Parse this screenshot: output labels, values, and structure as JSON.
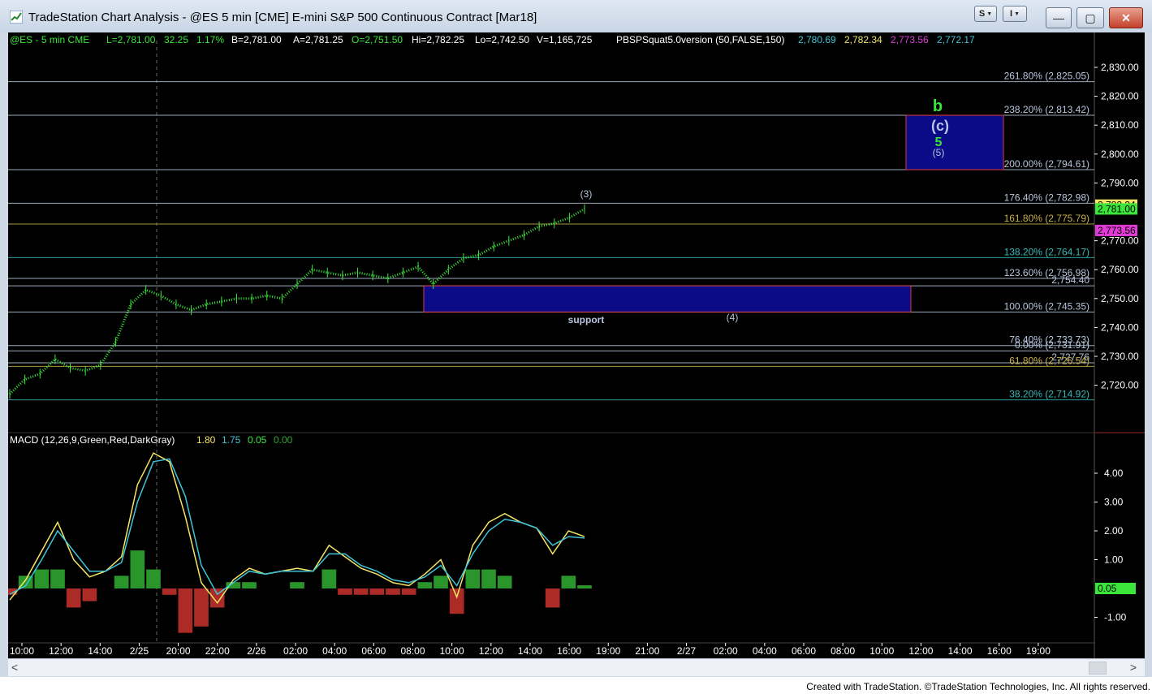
{
  "window": {
    "title": "TradeStation Chart Analysis - @ES 5 min [CME] E-mini S&P 500 Continuous Contract [Mar18]",
    "menu_s": "S",
    "menu_i": "I",
    "minimize_glyph": "—",
    "restore_glyph": "▢",
    "close_glyph": "✕"
  },
  "status": {
    "symbol": "@ES - 5 min  CME",
    "last": "L=2,781.00",
    "change": "32.25",
    "change_pct": "1.17%",
    "bid": "B=2,781.00",
    "ask": "A=2,781.25",
    "open": "O=2,751.50",
    "high": "Hi=2,782.25",
    "low": "Lo=2,742.50",
    "volume": "V=1,165,725",
    "indicator": "PBSPSquat5.0version (50,FALSE,150)",
    "ind_v1": "2,780.69",
    "ind_v2": "2,782.34",
    "ind_v3": "2,773.56",
    "ind_v4": "2,772.17"
  },
  "colors": {
    "background": "#000000",
    "price_green": "#39e639",
    "level_line": "#b7c6de",
    "box_fill": "#0b0b88",
    "box_border": "#e23a3a",
    "macd_line": "#f5e663",
    "signal_line": "#3ec4d6",
    "hist_pos": "#2fa52f",
    "hist_neg": "#c0302a",
    "axis_text": "#ffffff"
  },
  "price_axis": {
    "ticks": [
      "2,830.00",
      "2,820.00",
      "2,810.00",
      "2,800.00",
      "2,790.00",
      "2,770.00",
      "2,760.00",
      "2,750.00",
      "2,740.00",
      "2,730.00",
      "2,720.00"
    ]
  },
  "levels": [
    {
      "label": "261.80% (2,825.05)",
      "price": 2825.05,
      "color": "#b7c6de"
    },
    {
      "label": "238.20% (2,813.42)",
      "price": 2813.42,
      "color": "#b7c6de"
    },
    {
      "label": "200.00% (2,794.61)",
      "price": 2794.61,
      "color": "#b7c6de"
    },
    {
      "label": "176.40% (2,782.98)",
      "price": 2782.98,
      "color": "#b7c6de"
    },
    {
      "label": "161.80% (2,775.79)",
      "price": 2775.79,
      "color": "#c9b04a"
    },
    {
      "label": "138.20% (2,764.17)",
      "price": 2764.17,
      "color": "#3ab8b8"
    },
    {
      "label": "123.60% (2,756.98)",
      "price": 2756.98,
      "color": "#b7c6de"
    },
    {
      "label": "2,754.40",
      "price": 2754.4,
      "color": "#b7c6de"
    },
    {
      "label": "100.00% (2,745.35)",
      "price": 2745.35,
      "color": "#b7c6de"
    },
    {
      "label": "76.40% (2,733.73)",
      "price": 2733.73,
      "color": "#b7c6de"
    },
    {
      "label": "0.00% (2,731.91)",
      "price": 2731.91,
      "color": "#b7c6de"
    },
    {
      "label": "2,727.76",
      "price": 2727.76,
      "color": "#b7c6de"
    },
    {
      "label": "61.80% (2,726.54)",
      "price": 2726.54,
      "color": "#c9b04a"
    },
    {
      "label": "38.20% (2,714.92)",
      "price": 2714.92,
      "color": "#3ab8b8"
    }
  ],
  "price_tags": [
    {
      "text": "2,782.34",
      "price": 2782.34,
      "bg": "#f5e663",
      "fg": "#000000"
    },
    {
      "text": "2,781.00",
      "price": 2781.0,
      "bg": "#39e639",
      "fg": "#000000"
    },
    {
      "text": "2,773.56",
      "price": 2773.56,
      "bg": "#e23ad6",
      "fg": "#000000"
    }
  ],
  "annotations": {
    "wave_3": "(3)",
    "wave_4": "(4)",
    "wave_b": "b",
    "wave_c": "(c)",
    "wave_5": "5",
    "wave_5p": "(5)",
    "support": "support"
  },
  "target_box": {
    "price_top": 2813.42,
    "price_bottom": 2794.61
  },
  "support_box": {
    "price_top": 2754.4,
    "price_bottom": 2745.35
  },
  "macd": {
    "label": "MACD (12,26,9,Green,Red,DarkGray)",
    "v1": "1.80",
    "v2": "1.75",
    "v3": "0.05",
    "v4": "0.00",
    "ticks": [
      "4.00",
      "3.00",
      "2.00",
      "1.00",
      "-1.00"
    ],
    "tag": "0.05"
  },
  "time_axis": {
    "labels": [
      "10:00",
      "12:00",
      "14:00",
      "2/25",
      "20:00",
      "22:00",
      "2/26",
      "02:00",
      "04:00",
      "06:00",
      "08:00",
      "10:00",
      "12:00",
      "14:00",
      "16:00",
      "19:00",
      "21:00",
      "2/27",
      "02:00",
      "04:00",
      "06:00",
      "08:00",
      "10:00",
      "12:00",
      "14:00",
      "16:00",
      "19:00"
    ]
  },
  "chart_data": {
    "type": "line",
    "title": "",
    "price_range": [
      2710,
      2835
    ],
    "x_labels": [
      "10:00",
      "12:00",
      "14:00",
      "2/25",
      "20:00",
      "22:00",
      "2/26",
      "02:00",
      "04:00",
      "06:00",
      "08:00",
      "10:00",
      "12:00",
      "14:00",
      "16:00"
    ],
    "price_series": {
      "name": "",
      "values": [
        2717,
        2722,
        2724,
        2729,
        2726,
        2725,
        2727,
        2735,
        2748,
        2753,
        2751,
        2748,
        2746,
        2748,
        2749,
        2750,
        2750,
        2751,
        2750,
        2755,
        2760,
        2759,
        2758,
        2759,
        2758,
        2757,
        2759,
        2761,
        2755,
        2760,
        2764,
        2765,
        2768,
        2770,
        2772,
        2775,
        2776,
        2778,
        2781
      ]
    },
    "macd_range": [
      -1.4,
      5.0
    ],
    "macd_series": [
      {
        "name": "",
        "values": [
          -0.4,
          0.3,
          1.3,
          2.3,
          1.0,
          0.4,
          0.6,
          1.1,
          3.6,
          4.7,
          4.4,
          2.5,
          0.2,
          -0.5,
          0.3,
          0.7,
          0.5,
          0.6,
          0.7,
          0.6,
          1.5,
          1.1,
          0.7,
          0.5,
          0.2,
          0.1,
          0.5,
          1.0,
          -0.3,
          1.5,
          2.3,
          2.6,
          2.3,
          2.1,
          1.2,
          2.0,
          1.8
        ]
      },
      {
        "name": "",
        "values": [
          -0.2,
          0.1,
          1.0,
          2.0,
          1.3,
          0.6,
          0.6,
          0.9,
          3.0,
          4.4,
          4.5,
          3.2,
          0.8,
          -0.2,
          0.2,
          0.6,
          0.5,
          0.6,
          0.6,
          0.6,
          1.2,
          1.2,
          0.8,
          0.6,
          0.3,
          0.2,
          0.4,
          0.8,
          0.1,
          1.2,
          2.0,
          2.4,
          2.3,
          2.1,
          1.5,
          1.8,
          1.75
        ]
      }
    ],
    "histogram": [
      -0.1,
      0.2,
      0.3,
      0.3,
      -0.3,
      -0.2,
      0.0,
      0.2,
      0.6,
      0.3,
      -0.1,
      -0.7,
      -0.6,
      -0.3,
      0.1,
      0.1,
      0.0,
      0.0,
      0.1,
      0.0,
      0.3,
      -0.1,
      -0.1,
      -0.1,
      -0.1,
      -0.1,
      0.1,
      0.2,
      -0.4,
      0.3,
      0.3,
      0.2,
      0.0,
      0.0,
      -0.3,
      0.2,
      0.05
    ]
  },
  "credit": "Created with TradeStation. ©TradeStation Technologies, Inc. All rights reserved."
}
